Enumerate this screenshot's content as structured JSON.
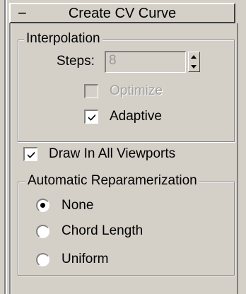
{
  "rollout": {
    "collapse_symbol": "−",
    "title": "Create CV Curve"
  },
  "interpolation": {
    "group_label": "Interpolation",
    "steps_label": "Steps:",
    "steps_value": "8",
    "optimize_label": "Optimize",
    "optimize_checked": false,
    "optimize_enabled": false,
    "adaptive_label": "Adaptive",
    "adaptive_checked": true
  },
  "draw_in_all_viewports": {
    "label": "Draw In All Viewports",
    "checked": true
  },
  "reparam": {
    "group_label": "Automatic Reparamerization",
    "options": [
      {
        "label": "None",
        "selected": true
      },
      {
        "label": "Chord Length",
        "selected": false
      },
      {
        "label": "Uniform",
        "selected": false
      }
    ]
  },
  "colors": {
    "panel": "#d4d0c8",
    "shadow": "#808080",
    "highlight": "#ffffff",
    "disabled_text": "#a0a0a0"
  }
}
